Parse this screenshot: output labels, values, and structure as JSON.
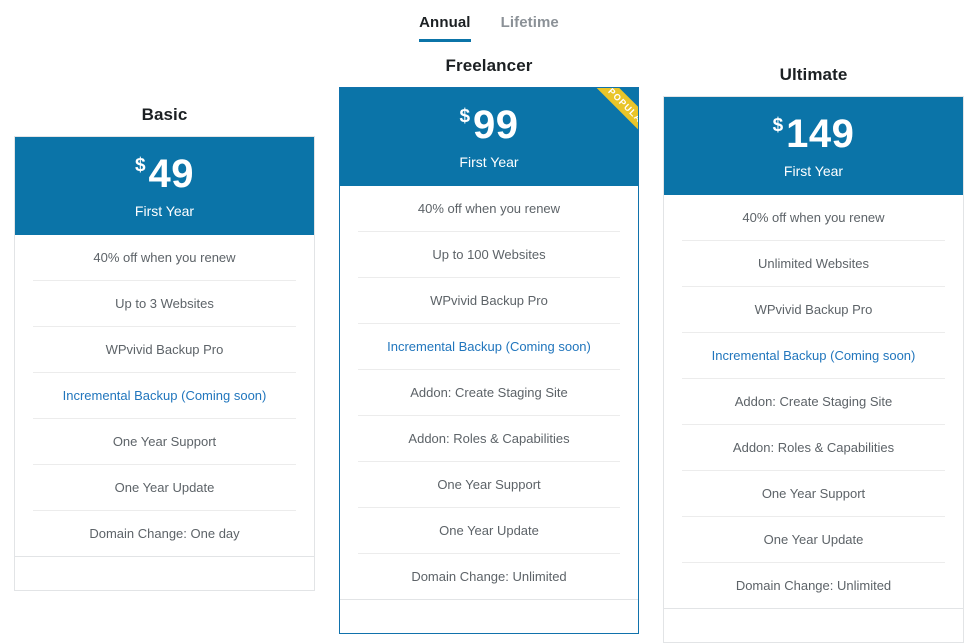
{
  "tabs": [
    {
      "label": "Annual",
      "state": "active"
    },
    {
      "label": "Lifetime",
      "state": "inactive"
    }
  ],
  "colors": {
    "header_blue": "#0b74a8",
    "ribbon_gold": "#e9c529",
    "link_blue": "#2176bd",
    "divider": "#ececec"
  },
  "plans": [
    {
      "name": "Basic",
      "currency": "$",
      "price": "49",
      "period": "First Year",
      "popular": false,
      "ribbon_label": "",
      "features": [
        {
          "text": "40% off when you renew",
          "link": false
        },
        {
          "text": "Up to 3 Websites",
          "link": false
        },
        {
          "text": "WPvivid Backup Pro",
          "link": false
        },
        {
          "text": "Incremental Backup (Coming soon)",
          "link": true
        },
        {
          "text": "One Year Support",
          "link": false
        },
        {
          "text": "One Year Update",
          "link": false
        },
        {
          "text": "Domain Change: One day",
          "link": false
        }
      ]
    },
    {
      "name": "Freelancer",
      "currency": "$",
      "price": "99",
      "period": "First Year",
      "popular": true,
      "ribbon_label": "POPULAR",
      "features": [
        {
          "text": "40% off when you renew",
          "link": false
        },
        {
          "text": "Up to 100 Websites",
          "link": false
        },
        {
          "text": "WPvivid Backup Pro",
          "link": false
        },
        {
          "text": "Incremental Backup (Coming soon)",
          "link": true
        },
        {
          "text": "Addon: Create Staging Site",
          "link": false
        },
        {
          "text": "Addon: Roles & Capabilities",
          "link": false
        },
        {
          "text": "One Year Support",
          "link": false
        },
        {
          "text": "One Year Update",
          "link": false
        },
        {
          "text": "Domain Change: Unlimited",
          "link": false
        }
      ]
    },
    {
      "name": "Ultimate",
      "currency": "$",
      "price": "149",
      "period": "First Year",
      "popular": false,
      "ribbon_label": "",
      "features": [
        {
          "text": "40% off when you renew",
          "link": false
        },
        {
          "text": "Unlimited Websites",
          "link": false
        },
        {
          "text": "WPvivid Backup Pro",
          "link": false
        },
        {
          "text": "Incremental Backup (Coming soon)",
          "link": true
        },
        {
          "text": "Addon: Create Staging Site",
          "link": false
        },
        {
          "text": "Addon: Roles & Capabilities",
          "link": false
        },
        {
          "text": "One Year Support",
          "link": false
        },
        {
          "text": "One Year Update",
          "link": false
        },
        {
          "text": "Domain Change: Unlimited",
          "link": false
        }
      ]
    }
  ]
}
